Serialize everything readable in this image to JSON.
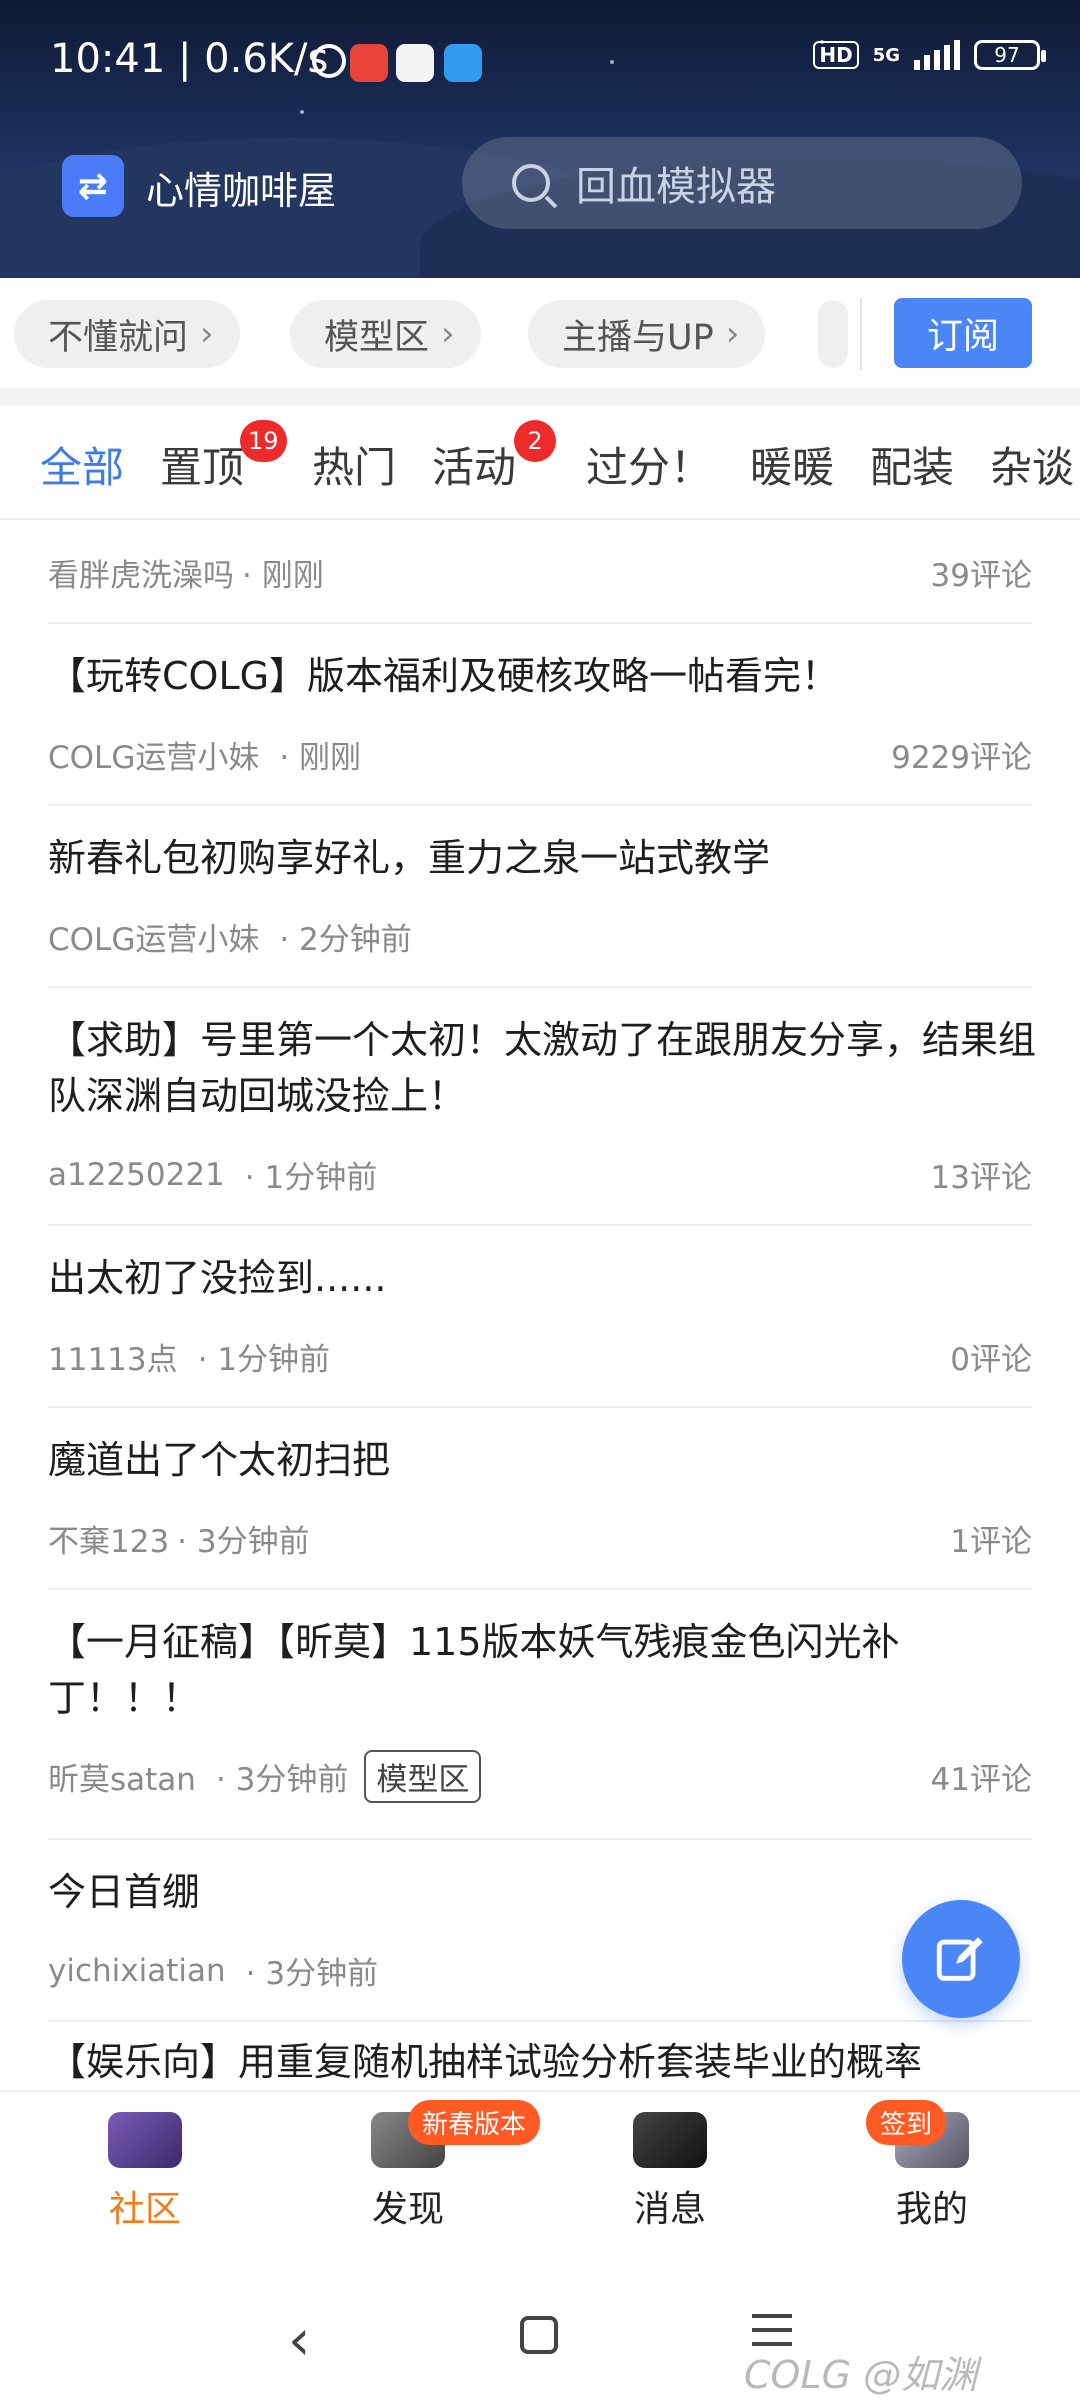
{
  "status_bar": {
    "time_speed": "10:41 | 0.6K/s",
    "network": "5G",
    "hd": "HD",
    "battery": "97"
  },
  "header": {
    "forum_name": "心情咖啡屋",
    "search_placeholder": "回血模拟器"
  },
  "chips": [
    {
      "label": "不懂就问"
    },
    {
      "label": "模型区"
    },
    {
      "label": "主播与UP"
    }
  ],
  "subscribe_label": "订阅",
  "tabs": [
    {
      "label": "全部",
      "active": true
    },
    {
      "label": "置顶",
      "badge": "19"
    },
    {
      "label": "热门"
    },
    {
      "label": "活动",
      "badge": "2"
    },
    {
      "label": "过分！"
    },
    {
      "label": "暖暖"
    },
    {
      "label": "配装"
    },
    {
      "label": "杂谈"
    }
  ],
  "posts": [
    {
      "title": "",
      "author": "看胖虎洗澡吗",
      "time": "· 刚刚",
      "comments": "39评论"
    },
    {
      "title": "【玩转COLG】版本福利及硬核攻略一帖看完！",
      "author": "COLG运营小妹",
      "time": "· 刚刚",
      "comments": "9229评论"
    },
    {
      "title": "新春礼包初购享好礼，重力之泉一站式教学",
      "author": "COLG运营小妹",
      "time": "· 2分钟前",
      "comments": ""
    },
    {
      "title": "【求助】号里第一个太初！太激动了在跟朋友分享，结果组队深渊自动回城没捡上！",
      "author": "a12250221",
      "time": "· 1分钟前",
      "comments": "13评论"
    },
    {
      "title": "出太初了没捡到......",
      "author": "11113点",
      "time": "· 1分钟前",
      "comments": "0评论"
    },
    {
      "title": "魔道出了个太初扫把",
      "author": "不棄123",
      "time": "· 3分钟前",
      "comments": "1评论"
    },
    {
      "title": "【一月征稿】【昕莫】115版本妖气残痕金色闪光补丁！！！",
      "author": "昕莫satan",
      "time": "· 3分钟前",
      "tag": "模型区",
      "comments": "41评论"
    },
    {
      "title": "今日首绷",
      "author": "yichixiatian",
      "time": "· 3分钟前",
      "comments": ""
    },
    {
      "title": "【娱乐向】用重复随机抽样试验分析套装毕业的概率",
      "author": "",
      "time": "",
      "comments": ""
    }
  ],
  "bottom_nav": [
    {
      "label": "社区",
      "active": true
    },
    {
      "label": "发现",
      "badge": "新春版本"
    },
    {
      "label": "消息"
    },
    {
      "label": "我的",
      "badge": "签到"
    }
  ],
  "watermark": "COLG @如渊",
  "colors": {
    "accent": "#4a86f5",
    "tab_active": "#3f7be8",
    "nav_active": "#f07d1a",
    "badge_red": "#ee2b2b"
  }
}
